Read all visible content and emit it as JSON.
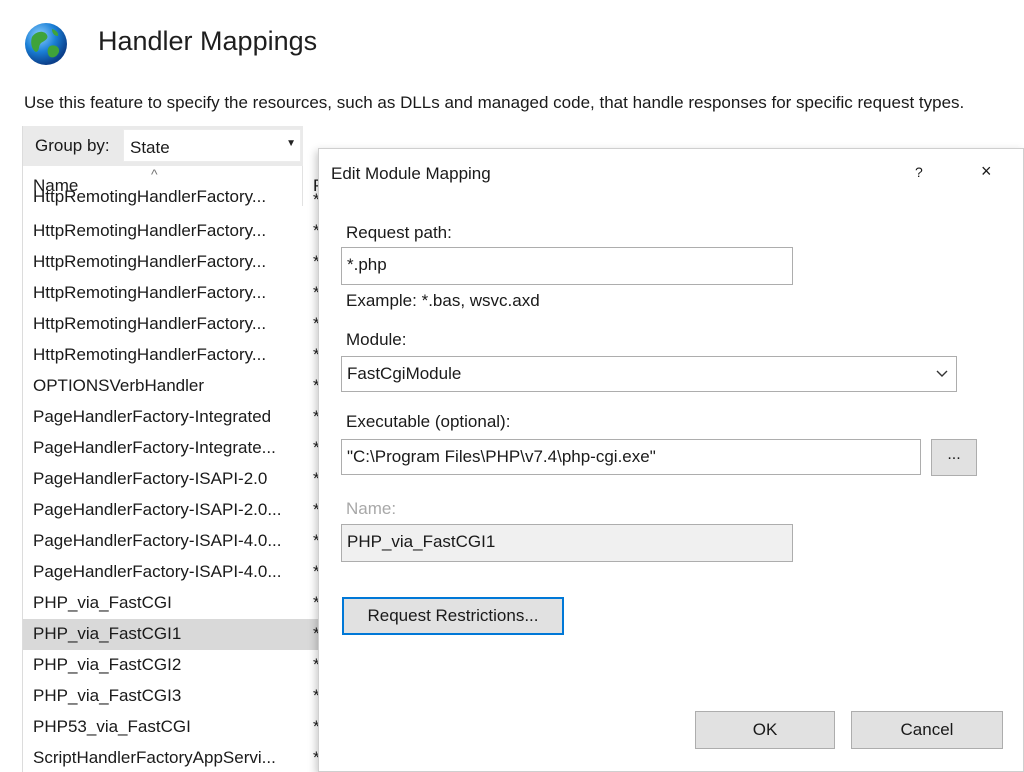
{
  "page": {
    "title": "Handler Mappings",
    "description": "Use this feature to specify the resources, such as DLLs and managed code, that handle responses for specific request types.",
    "icon": "globe-icon"
  },
  "list": {
    "group_by_label": "Group by:",
    "group_by_value": "State",
    "columns": {
      "name": "Name",
      "path": "P"
    },
    "rows": [
      {
        "name": "HttpRemotingHandlerFactory...",
        "path": "*"
      },
      {
        "name": "HttpRemotingHandlerFactory...",
        "path": "*"
      },
      {
        "name": "HttpRemotingHandlerFactory...",
        "path": "*"
      },
      {
        "name": "HttpRemotingHandlerFactory...",
        "path": "*"
      },
      {
        "name": "HttpRemotingHandlerFactory...",
        "path": "*"
      },
      {
        "name": "HttpRemotingHandlerFactory...",
        "path": "*"
      },
      {
        "name": "OPTIONSVerbHandler",
        "path": "*"
      },
      {
        "name": "PageHandlerFactory-Integrated",
        "path": "*"
      },
      {
        "name": "PageHandlerFactory-Integrate...",
        "path": "*"
      },
      {
        "name": "PageHandlerFactory-ISAPI-2.0",
        "path": "*"
      },
      {
        "name": "PageHandlerFactory-ISAPI-2.0...",
        "path": "*"
      },
      {
        "name": "PageHandlerFactory-ISAPI-4.0...",
        "path": "*"
      },
      {
        "name": "PageHandlerFactory-ISAPI-4.0...",
        "path": "*"
      },
      {
        "name": "PHP_via_FastCGI",
        "path": "*"
      },
      {
        "name": "PHP_via_FastCGI1",
        "path": "*",
        "selected": true
      },
      {
        "name": "PHP_via_FastCGI2",
        "path": "*"
      },
      {
        "name": "PHP_via_FastCGI3",
        "path": "*"
      },
      {
        "name": "PHP53_via_FastCGI",
        "path": "*"
      },
      {
        "name": "ScriptHandlerFactoryAppServi...",
        "path": "*"
      }
    ]
  },
  "dialog": {
    "title": "Edit Module Mapping",
    "help_label": "?",
    "close_label": "×",
    "request_path_label": "Request path:",
    "request_path_value": "*.php",
    "request_path_example": "Example: *.bas, wsvc.axd",
    "module_label": "Module:",
    "module_value": "FastCgiModule",
    "executable_label": "Executable (optional):",
    "executable_value": "\"C:\\Program Files\\PHP\\v7.4\\php-cgi.exe\"",
    "browse_label": "...",
    "name_label": "Name:",
    "name_value": "PHP_via_FastCGI1",
    "restrictions_label": "Request Restrictions...",
    "ok_label": "OK",
    "cancel_label": "Cancel"
  },
  "colors": {
    "accent": "#0078d7",
    "selected_row": "#d9d9d9",
    "button_face": "#e1e1e1"
  }
}
